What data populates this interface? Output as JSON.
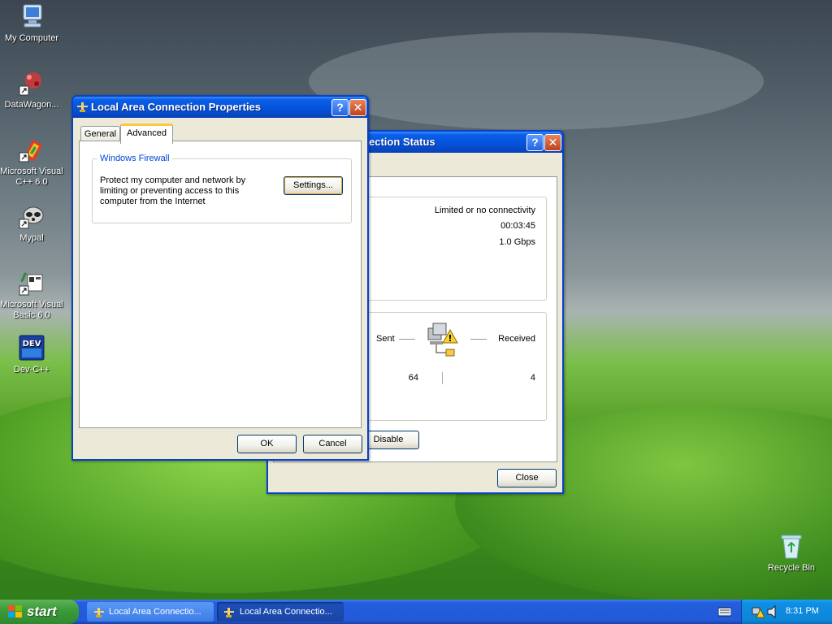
{
  "desktop": {
    "icons": [
      {
        "label": "My Computer"
      },
      {
        "label": "DataWagon..."
      },
      {
        "label": "Microsoft Visual C++ 6.0"
      },
      {
        "label": "Mypal"
      },
      {
        "label": "Microsoft Visual Basic 6.0"
      },
      {
        "label": "Dev-C++"
      },
      {
        "label": "Recycle Bin"
      }
    ]
  },
  "status_window": {
    "title": "ection Status",
    "connection": {
      "status": "Limited or no connectivity",
      "duration": "00:03:45",
      "speed": "1.0 Gbps"
    },
    "activity": {
      "sent_label": "Sent",
      "received_label": "Received",
      "sent_value": "64",
      "received_value": "4"
    },
    "disable_label": "Disable",
    "close_label": "Close"
  },
  "props_window": {
    "title": "Local Area Connection Properties",
    "tabs": [
      {
        "label": "General"
      },
      {
        "label": "Advanced"
      }
    ],
    "firewall": {
      "group_label": "Windows Firewall",
      "description": "Protect my computer and network by limiting or preventing access to this computer from the Internet",
      "settings_label": "Settings..."
    },
    "ok_label": "OK",
    "cancel_label": "Cancel"
  },
  "taskbar": {
    "start_label": "start",
    "tasks": [
      {
        "label": "Local Area Connectio..."
      },
      {
        "label": "Local Area Connectio..."
      }
    ],
    "clock": "8:31 PM"
  },
  "colors": {
    "xp_blue": "#0552d9",
    "start_green": "#3d9c3a",
    "tray_blue": "#0f8ee3",
    "close_red": "#c0411b"
  },
  "icons": [
    "monitor-icon",
    "network-shortcut-icon",
    "vc6-icon",
    "raccoon-icon",
    "vb6-icon",
    "dev-icon",
    "recycle-bin-icon",
    "network-connection-icon",
    "help-icon",
    "close-icon",
    "windows-flag-icon",
    "keyboard-icon",
    "network-warning-icon",
    "speaker-icon"
  ]
}
